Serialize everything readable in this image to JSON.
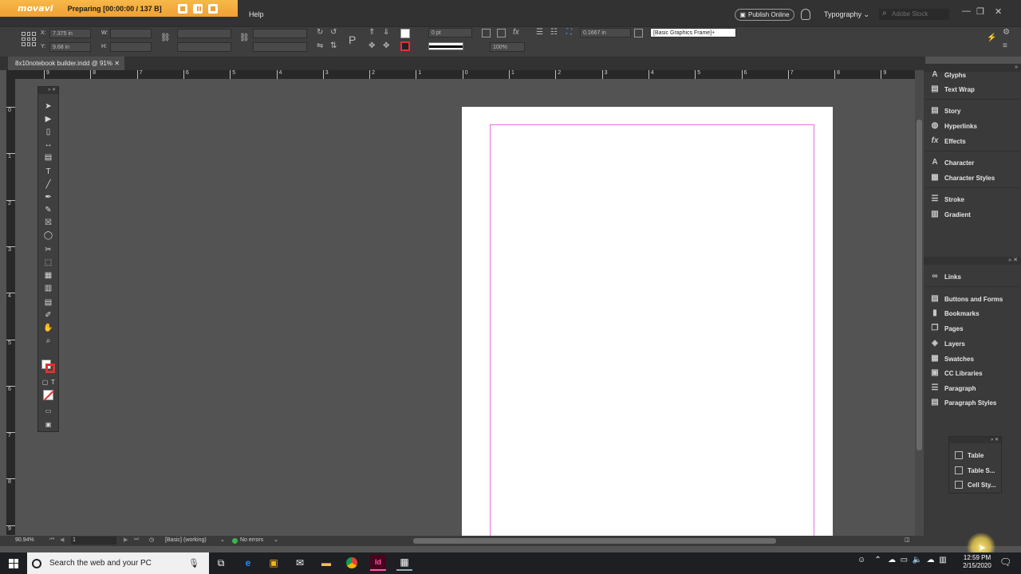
{
  "recorder": {
    "logo": "movavi",
    "status": "Preparing  [00:00:00 / 137 B]"
  },
  "menu": {
    "help": "Help",
    "publish": "Publish Online",
    "workspace": "Typography",
    "stock_placeholder": "Adobe Stock"
  },
  "control": {
    "x_label": "X:",
    "x_value": "7.375 in",
    "y_label": "Y:",
    "y_value": "9.68 in",
    "w_label": "W:",
    "h_label": "H:",
    "stroke_weight": "0 pt",
    "scale": "100%",
    "offset": "0.1667 in",
    "object_style": "[Basic Graphics Frame]+"
  },
  "document": {
    "tab_title": "8x10notebook builder.indd @ 91%"
  },
  "ruler": {
    "h_ticks": [
      "9",
      "8",
      "7",
      "6",
      "5",
      "4",
      "3",
      "2",
      "1",
      "0",
      "1",
      "2",
      "3",
      "4",
      "5",
      "6",
      "7",
      "8",
      "9"
    ],
    "v_ticks": [
      "0",
      "1",
      "2",
      "3",
      "4",
      "5",
      "6",
      "7",
      "8",
      "9"
    ]
  },
  "status": {
    "zoom": "90.94%",
    "page": "1",
    "style": "[Basic] (working)",
    "preflight": "No errors"
  },
  "panels": {
    "group1": [
      "Glyphs",
      "Text Wrap"
    ],
    "group2": [
      "Story",
      "Hyperlinks",
      "Effects"
    ],
    "group3": [
      "Character",
      "Character Styles"
    ],
    "group4": [
      "Stroke",
      "Gradient"
    ],
    "group5": [
      "Links"
    ],
    "group6": [
      "Buttons and Forms",
      "Bookmarks",
      "Pages",
      "Layers",
      "Swatches",
      "CC Libraries",
      "Paragraph",
      "Paragraph Styles"
    ],
    "floating": [
      "Table",
      "Table S...",
      "Cell Sty..."
    ]
  },
  "taskbar": {
    "search_placeholder": "Search the web and your PC",
    "time": "12:59 PM",
    "date": "2/15/2020"
  },
  "colors": {
    "margin_guide": "#e673e0",
    "recorder_bar": "#f0a035",
    "indesign_brand": "#49021f"
  }
}
